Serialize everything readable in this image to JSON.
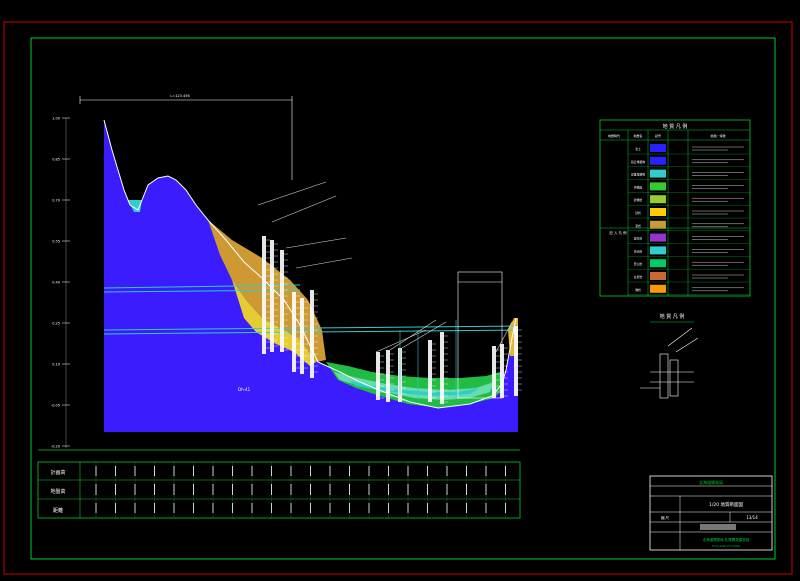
{
  "drawing": {
    "frame_color": "#cc0000",
    "border_color": "#00cc33",
    "profile_values_top": [
      "1.00",
      "0.85",
      "0.70",
      "0.55",
      "0.40",
      "0.25",
      "0.10",
      "-0.05",
      "-0.20"
    ],
    "bottom_table": {
      "row_labels": [
        "計画高",
        "地盤高",
        "距離"
      ]
    },
    "legend_title": "地 質 凡 例",
    "legend_headers": [
      "地層時代",
      "地層名",
      "記号",
      "岩相・特徴"
    ],
    "legend_rows": [
      {
        "swatch": "#2a1fff",
        "name": "表土"
      },
      {
        "swatch": "#2a1fff",
        "name": "段丘堆積物"
      },
      {
        "swatch": "#33cccc",
        "name": "崖錐堆積物"
      },
      {
        "swatch": "#33cc33",
        "name": "沖積層"
      },
      {
        "swatch": "#99cc33",
        "name": "砂礫層"
      },
      {
        "swatch": "#ffcc00",
        "name": "砂岩"
      },
      {
        "swatch": "#cc9933",
        "name": "泥岩"
      },
      {
        "swatch": "#9933cc",
        "name": "凝灰岩"
      },
      {
        "swatch": "#33cccc",
        "name": "花崗岩"
      },
      {
        "swatch": "#00cc66",
        "name": "安山岩"
      },
      {
        "swatch": "#cc6633",
        "name": "玄武岩"
      },
      {
        "swatch": "#ff9900",
        "name": "礫岩"
      }
    ],
    "legend_sub": "記 入 凡 例",
    "detail_title": "地 質 凡 例",
    "title_block": {
      "org": "北海道開発局",
      "project": "1/20 地質断面図",
      "scale_label": "縮 尺",
      "sheet": "13/14",
      "page": "H=1:200 V=1:200",
      "office": "北海道開発局 札幌開発建設部"
    },
    "label_mark": "Dh-41",
    "top_dimension": "L=123.456"
  }
}
